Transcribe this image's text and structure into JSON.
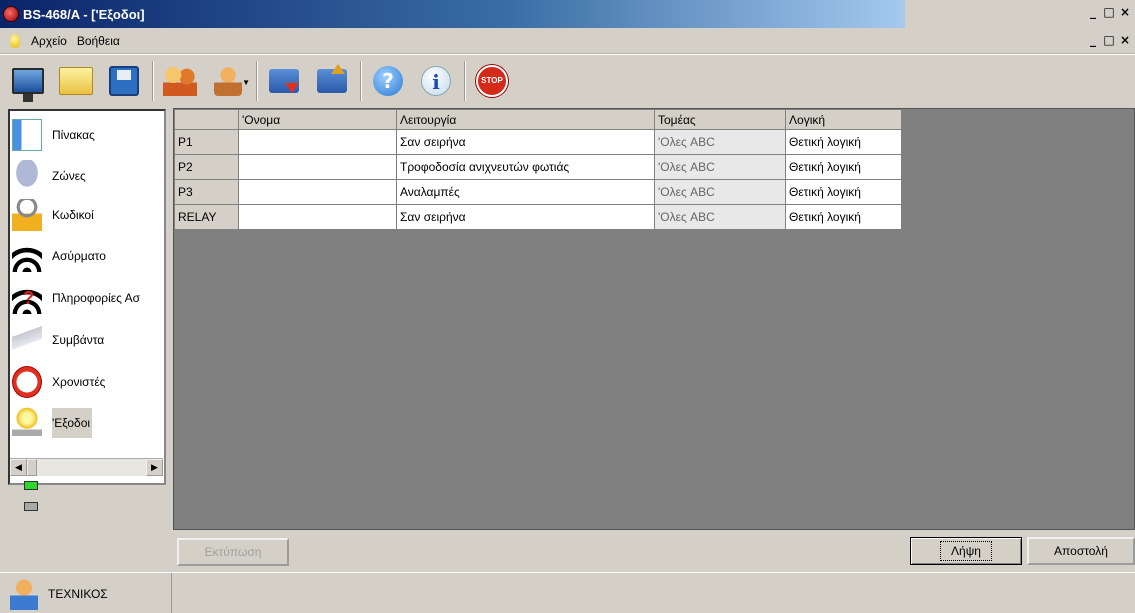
{
  "window": {
    "title": "BS-468/A - ['Εξοδοι]",
    "controls": [
      "_",
      "□",
      "×"
    ]
  },
  "menu": {
    "items": [
      "Αρχείο",
      "Βοήθεια"
    ]
  },
  "toolbar": {
    "icons": [
      "monitor-icon",
      "folder-icon",
      "save-icon",
      "users-icon",
      "user-dropdown-icon",
      "download-icon",
      "upload-icon",
      "help-icon",
      "info-icon",
      "stop-icon"
    ],
    "stop_label": "STOP"
  },
  "sidebar": {
    "items": [
      {
        "label": "Πίνακας",
        "icon": "table-icon"
      },
      {
        "label": "Ζώνες",
        "icon": "bell-icon"
      },
      {
        "label": "Κωδικοί",
        "icon": "lock-icon"
      },
      {
        "label": "Ασύρματο",
        "icon": "wireless-icon"
      },
      {
        "label": "Πληροφορίες Ασ",
        "icon": "wireless-info-icon"
      },
      {
        "label": "Συμβάντα",
        "icon": "events-icon"
      },
      {
        "label": "Χρονιστές",
        "icon": "clock-icon"
      },
      {
        "label": "'Εξοδοι",
        "icon": "bulb-icon",
        "selected": true
      }
    ],
    "status_colors": {
      "connected": "#2bd82b",
      "idle": "#a8a8a8"
    }
  },
  "grid": {
    "columns": [
      "",
      "'Ονομα",
      "Λειτουργία",
      "Τομέας",
      "Λογική"
    ],
    "rows": [
      {
        "id": "P1",
        "name": "",
        "function": "Σαν σειρήνα",
        "sector": "'Ολες ABC",
        "logic": "Θετική λογική"
      },
      {
        "id": "P2",
        "name": "",
        "function": "Τροφοδοσία ανιχνευτών φωτιάς",
        "sector": "'Ολες ABC",
        "logic": "Θετική λογική"
      },
      {
        "id": "P3",
        "name": "",
        "function": "Αναλαμπές",
        "sector": "'Ολες ABC",
        "logic": "Θετική λογική"
      },
      {
        "id": "RELAY",
        "name": "",
        "function": "Σαν σειρήνα",
        "sector": "'Ολες ABC",
        "logic": "Θετική λογική"
      }
    ]
  },
  "buttons": {
    "print": "Εκτύπωση",
    "receive": "Λήψη",
    "send": "Αποστολή"
  },
  "status": {
    "user": "ΤΕΧΝΙΚΟΣ"
  }
}
